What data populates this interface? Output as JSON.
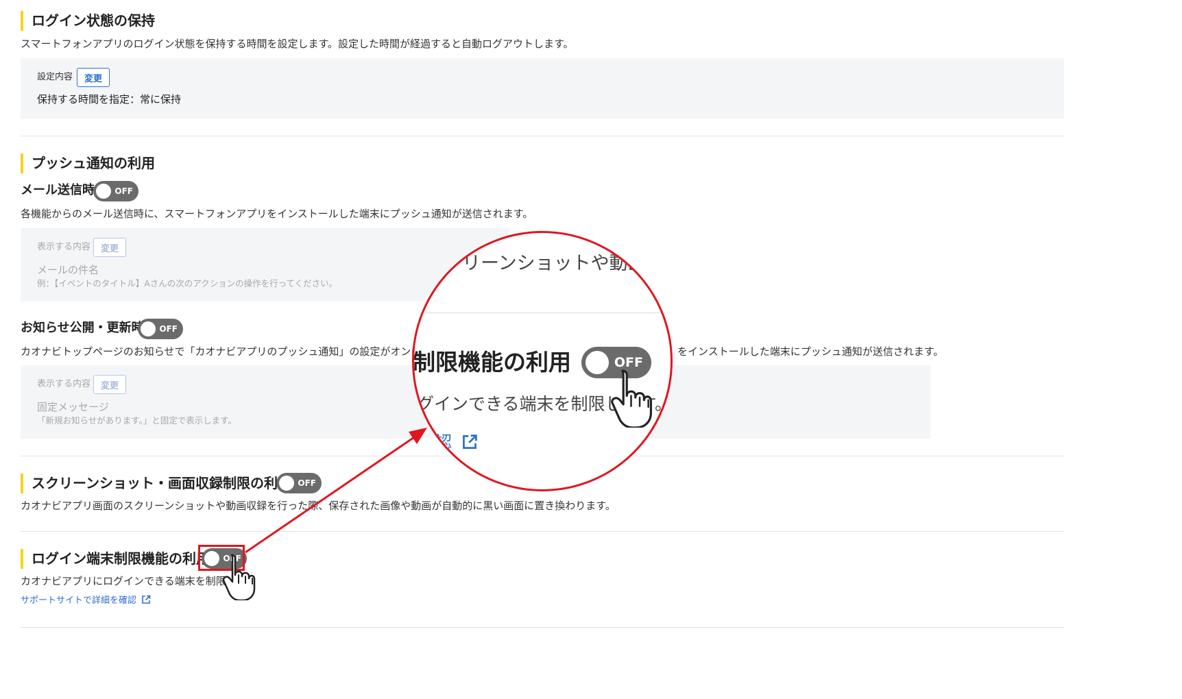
{
  "login_keep": {
    "title": "ログイン状態の保持",
    "description": "スマートフォンアプリのログイン状態を保持する時間を設定します。設定した時間が経過すると自動ログアウトします。",
    "setting_label": "設定内容",
    "change_label": "変更",
    "value": "保持する時間を指定：常に保持"
  },
  "push": {
    "title": "プッシュ通知の利用",
    "mail": {
      "title": "メール送信時",
      "toggle": "OFF",
      "description": "各機能からのメール送信時に、スマートフォンアプリをインストールした端末にプッシュ通知が送信されます。",
      "display_label": "表示する内容",
      "change_label": "変更",
      "value": "メールの件名",
      "example": "例：【イベントのタイトル】Aさんの次のアクションの操作を行ってください。"
    },
    "notice": {
      "title": "お知らせ公開・更新時",
      "toggle": "OFF",
      "description_left": "カオナビトップページのお知らせで「カオナビアプリのプッシュ通知」の設定がオンにな",
      "description_right": "をインストールした端末にプッシュ通知が送信されます。",
      "display_label": "表示する内容",
      "change_label": "変更",
      "value": "固定メッセージ",
      "example": "「新規お知らせがあります。」と固定で表示します。"
    }
  },
  "screenshot": {
    "title": "スクリーンショット・画面収録制限の利用",
    "toggle": "OFF",
    "description": "カオナビアプリ画面のスクリーンショットや動画収録を行った際、保存された画像や動画が自動的に黒い画面に置き換わります。"
  },
  "login_device": {
    "title": "ログイン端末制限機能の利用",
    "toggle": "OFF",
    "description": "カオナビアプリにログインできる端末を制限し",
    "link": "サポートサイトで詳細を確認"
  },
  "zoom": {
    "top_text": "リーンショットや動画",
    "title": "制限機能の利用",
    "toggle": "OFF",
    "description": "グインできる端末を制限します。",
    "link_fragment": "認"
  },
  "colors": {
    "accent_bar": "#f5d31f",
    "link": "#2d6fd1",
    "toggle_off": "#6b6b6b",
    "highlight": "#e0161f"
  }
}
